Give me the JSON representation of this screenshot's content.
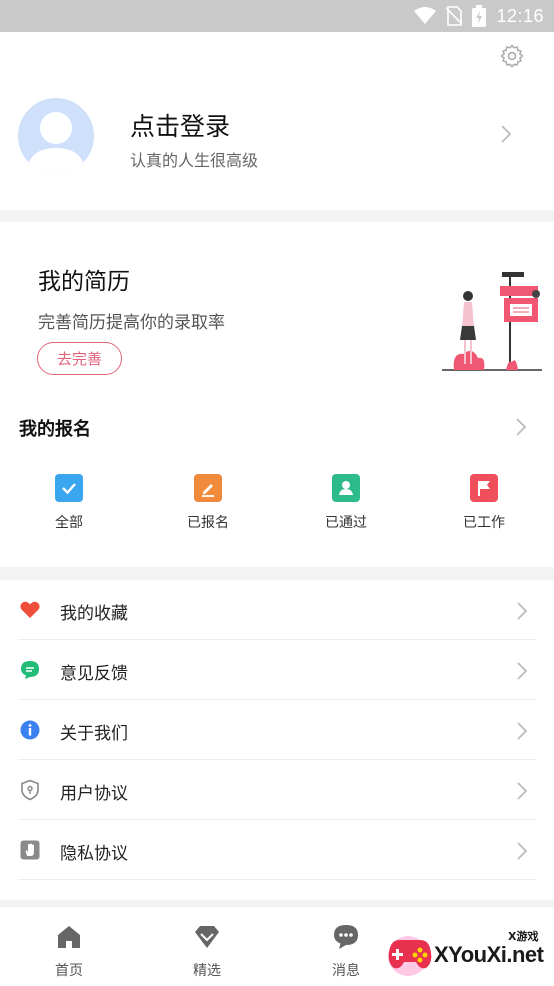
{
  "status_bar": {
    "time": "12:16",
    "icons": [
      "wifi-icon",
      "no-sim-icon",
      "battery-icon"
    ]
  },
  "profile": {
    "title": "点击登录",
    "subtitle": "认真的人生很高级",
    "icons": [
      "gear-icon",
      "avatar-icon",
      "chevron-right-icon"
    ]
  },
  "resume": {
    "title": "我的简历",
    "subtitle": "完善简历提高你的录取率",
    "button": "去完善",
    "accent": "#e2647c"
  },
  "signup": {
    "title": "我的报名",
    "items": [
      {
        "label": "全部",
        "icon": "check-icon",
        "color": "#3aa6f0"
      },
      {
        "label": "已报名",
        "icon": "pencil-icon",
        "color": "#f28a3c"
      },
      {
        "label": "已通过",
        "icon": "user-card-icon",
        "color": "#2dbb8c"
      },
      {
        "label": "已工作",
        "icon": "flag-icon",
        "color": "#ef4f5a"
      }
    ]
  },
  "menu": [
    {
      "label": "我的收藏",
      "icon": "heart-icon",
      "color": "#ef4f3a"
    },
    {
      "label": "意见反馈",
      "icon": "chat-bubble-icon",
      "color": "#22bb77"
    },
    {
      "label": "关于我们",
      "icon": "info-icon",
      "color": "#3b82f0"
    },
    {
      "label": "用户协议",
      "icon": "shield-icon",
      "color": "#888888"
    },
    {
      "label": "隐私协议",
      "icon": "hand-icon",
      "color": "#888888"
    }
  ],
  "tabbar": [
    {
      "label": "首页",
      "icon": "home-icon"
    },
    {
      "label": "精选",
      "icon": "diamond-icon"
    },
    {
      "label": "消息",
      "icon": "message-icon"
    }
  ],
  "watermark": {
    "brand": "XYouXi.net",
    "tag": "X游戏"
  }
}
